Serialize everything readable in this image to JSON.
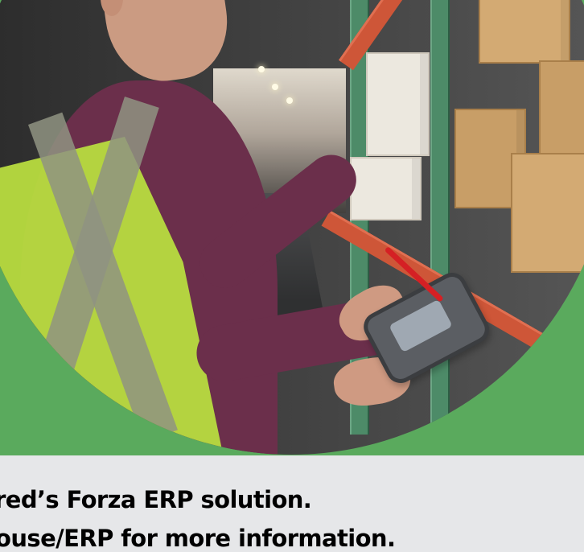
{
  "caption": {
    "line1": "ered’s Forza ERP solution.",
    "line2": "house/ERP for more information."
  },
  "colors": {
    "accent_green": "#5aaa5d",
    "background_gray": "#e6e7e9",
    "vest_yellow": "#b8dc3f",
    "shelf_orange": "#ce5638",
    "shelf_green": "#4d8b68"
  }
}
